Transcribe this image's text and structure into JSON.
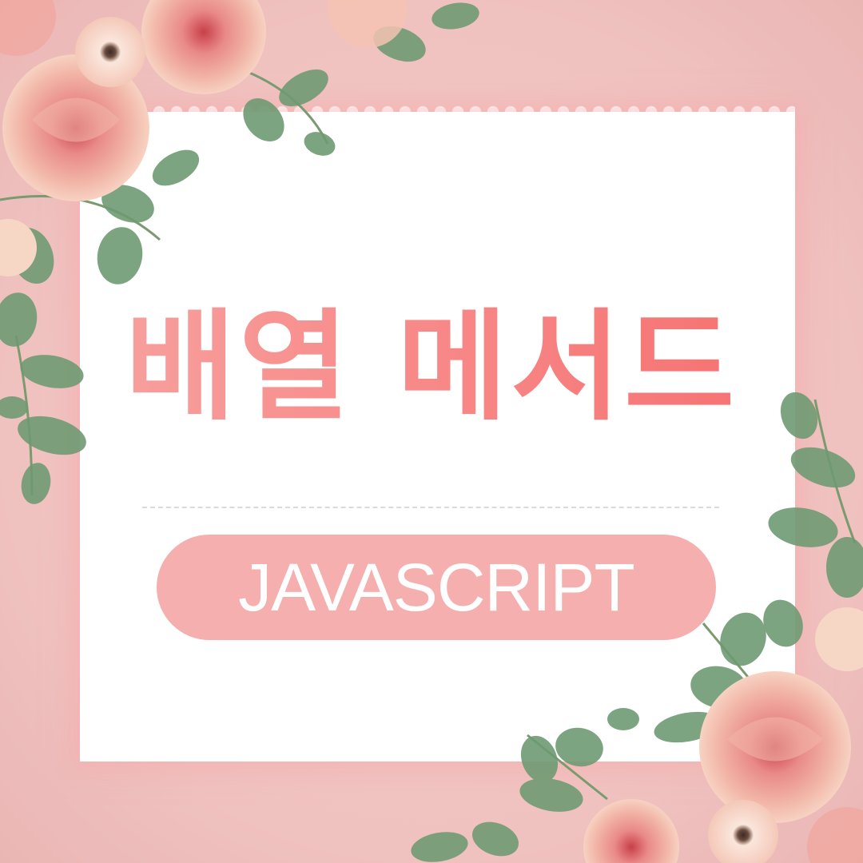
{
  "title": "배열 메서드",
  "subtitle": "JAVASCRIPT",
  "colors": {
    "background": "#efc1bf",
    "card": "#ffffff",
    "title_gradient_start": "#f7a7a4",
    "title_gradient_end": "#f56b6c",
    "pill": "#f5afae",
    "pill_text": "#ffffff",
    "leaf": "#6f9a72",
    "rose": "#ee9d98"
  },
  "decorations": [
    "watercolor-roses-top-left",
    "watercolor-roses-bottom-right",
    "eucalyptus-leaves"
  ]
}
